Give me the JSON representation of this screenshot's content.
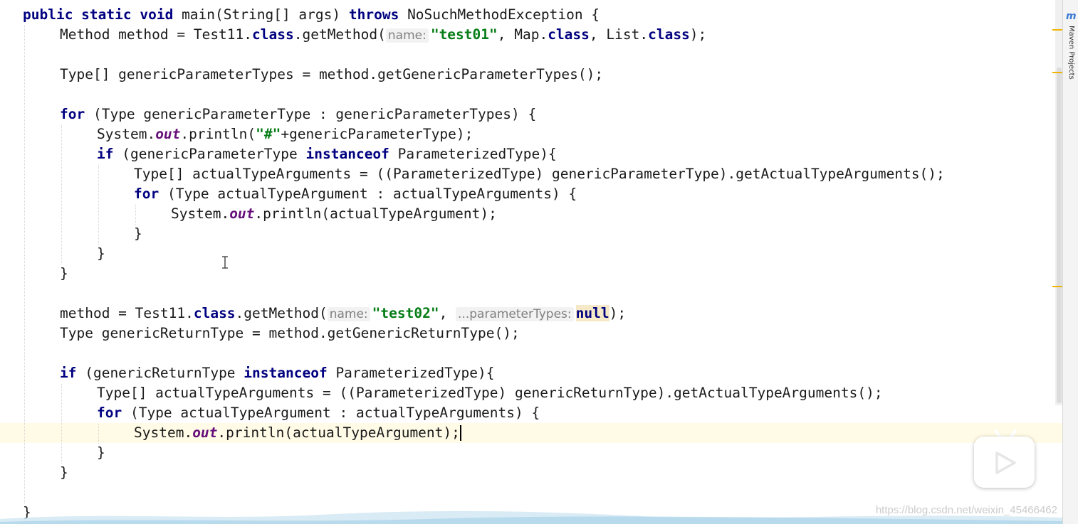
{
  "editor": {
    "lines": [
      {
        "indent": 0,
        "current": false,
        "tokens": [
          {
            "k": "kw",
            "t": "public static void"
          },
          {
            "k": "",
            "t": " main(String[] args) "
          },
          {
            "k": "kw",
            "t": "throws"
          },
          {
            "k": "",
            "t": " NoSuchMethodException {"
          }
        ]
      },
      {
        "indent": 1,
        "current": false,
        "tokens": [
          {
            "k": "",
            "t": "Method method = Test11."
          },
          {
            "k": "kw",
            "t": "class"
          },
          {
            "k": "",
            "t": ".getMethod("
          },
          {
            "k": "hint",
            "t": "name:"
          },
          {
            "k": "str",
            "t": "\"test01\""
          },
          {
            "k": "",
            "t": ", Map."
          },
          {
            "k": "kw",
            "t": "class"
          },
          {
            "k": "",
            "t": ", List."
          },
          {
            "k": "kw",
            "t": "class"
          },
          {
            "k": "",
            "t": ");"
          }
        ]
      },
      {
        "indent": 0,
        "current": false,
        "tokens": []
      },
      {
        "indent": 1,
        "current": false,
        "tokens": [
          {
            "k": "",
            "t": "Type[] genericParameterTypes = method.getGenericParameterTypes();"
          }
        ]
      },
      {
        "indent": 0,
        "current": false,
        "tokens": []
      },
      {
        "indent": 1,
        "current": false,
        "tokens": [
          {
            "k": "kw",
            "t": "for"
          },
          {
            "k": "",
            "t": " (Type genericParameterType : genericParameterTypes) {"
          }
        ]
      },
      {
        "indent": 2,
        "current": false,
        "tokens": [
          {
            "k": "",
            "t": "System."
          },
          {
            "k": "fld",
            "t": "out"
          },
          {
            "k": "",
            "t": ".println("
          },
          {
            "k": "str",
            "t": "\"#\""
          },
          {
            "k": "",
            "t": "+genericParameterType);"
          }
        ]
      },
      {
        "indent": 2,
        "current": false,
        "tokens": [
          {
            "k": "kw",
            "t": "if"
          },
          {
            "k": "",
            "t": " (genericParameterType "
          },
          {
            "k": "kw",
            "t": "instanceof"
          },
          {
            "k": "",
            "t": " ParameterizedType){"
          }
        ]
      },
      {
        "indent": 3,
        "current": false,
        "tokens": [
          {
            "k": "",
            "t": "Type[] actualTypeArguments = ((ParameterizedType) genericParameterType).getActualTypeArguments();"
          }
        ]
      },
      {
        "indent": 3,
        "current": false,
        "tokens": [
          {
            "k": "kw",
            "t": "for"
          },
          {
            "k": "",
            "t": " (Type actualTypeArgument : actualTypeArguments) {"
          }
        ]
      },
      {
        "indent": 4,
        "current": false,
        "tokens": [
          {
            "k": "",
            "t": "System."
          },
          {
            "k": "fld",
            "t": "out"
          },
          {
            "k": "",
            "t": ".println(actualTypeArgument);"
          }
        ]
      },
      {
        "indent": 3,
        "current": false,
        "tokens": [
          {
            "k": "",
            "t": "}"
          }
        ]
      },
      {
        "indent": 2,
        "current": false,
        "tokens": [
          {
            "k": "",
            "t": "}"
          }
        ]
      },
      {
        "indent": 1,
        "current": false,
        "tokens": [
          {
            "k": "",
            "t": "}"
          }
        ]
      },
      {
        "indent": 0,
        "current": false,
        "tokens": []
      },
      {
        "indent": 1,
        "current": false,
        "tokens": [
          {
            "k": "",
            "t": "method = Test11."
          },
          {
            "k": "kw",
            "t": "class"
          },
          {
            "k": "",
            "t": ".getMethod("
          },
          {
            "k": "hint",
            "t": "name:"
          },
          {
            "k": "str",
            "t": "\"test02\""
          },
          {
            "k": "",
            "t": ", "
          },
          {
            "k": "hint",
            "t": "...parameterTypes:"
          },
          {
            "k": "kw nullhl",
            "t": "null"
          },
          {
            "k": "",
            "t": ");"
          }
        ]
      },
      {
        "indent": 1,
        "current": false,
        "tokens": [
          {
            "k": "",
            "t": "Type genericReturnType = method.getGenericReturnType();"
          }
        ]
      },
      {
        "indent": 0,
        "current": false,
        "tokens": []
      },
      {
        "indent": 1,
        "current": false,
        "tokens": [
          {
            "k": "kw",
            "t": "if"
          },
          {
            "k": "",
            "t": " (genericReturnType "
          },
          {
            "k": "kw",
            "t": "instanceof"
          },
          {
            "k": "",
            "t": " ParameterizedType){"
          }
        ]
      },
      {
        "indent": 2,
        "current": false,
        "tokens": [
          {
            "k": "",
            "t": "Type[] actualTypeArguments = ((ParameterizedType) genericReturnType).getActualTypeArguments();"
          }
        ]
      },
      {
        "indent": 2,
        "current": false,
        "tokens": [
          {
            "k": "kw",
            "t": "for"
          },
          {
            "k": "",
            "t": " (Type actualTypeArgument : actualTypeArguments) {"
          }
        ]
      },
      {
        "indent": 3,
        "current": true,
        "caret": true,
        "tokens": [
          {
            "k": "",
            "t": "System."
          },
          {
            "k": "fld",
            "t": "out"
          },
          {
            "k": "",
            "t": ".println(actualTypeArgument);"
          }
        ]
      },
      {
        "indent": 2,
        "current": false,
        "tokens": [
          {
            "k": "",
            "t": "}"
          }
        ]
      },
      {
        "indent": 1,
        "current": false,
        "tokens": [
          {
            "k": "",
            "t": "}"
          }
        ]
      },
      {
        "indent": 0,
        "current": false,
        "tokens": []
      },
      {
        "indent": 0,
        "current": false,
        "tokens": [
          {
            "k": "",
            "t": "}"
          }
        ]
      }
    ]
  },
  "side_panel": {
    "maven_icon": "m",
    "maven_label": "Maven Projects"
  },
  "overlay": {
    "watermark": "https://blog.csdn.net/weixin_45466462"
  },
  "colors": {
    "keyword": "#000080",
    "string": "#067d17",
    "field": "#660e7a",
    "current_line": "#fffbe6",
    "marker": "#f0b400"
  }
}
